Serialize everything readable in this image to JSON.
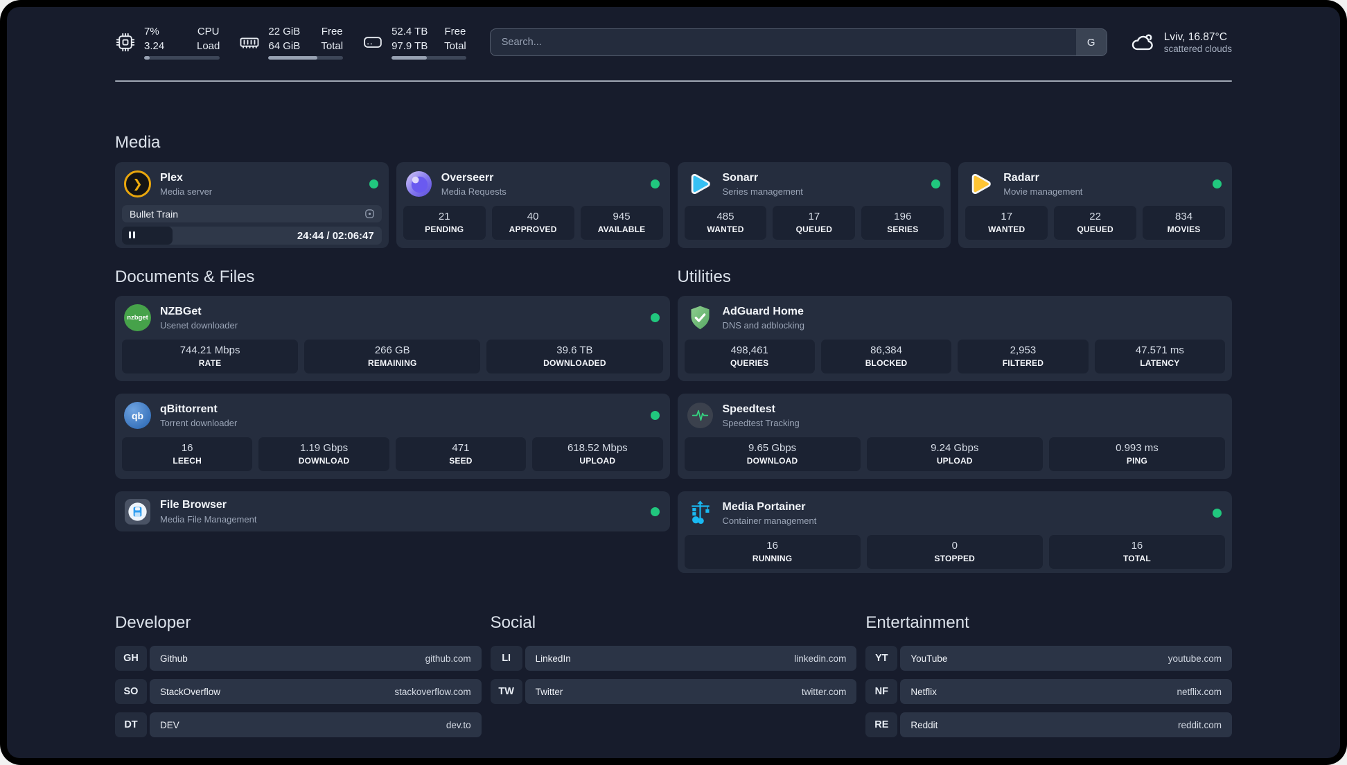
{
  "app": {
    "colors": {
      "accent_green": "#21c77e",
      "panel_bg": "#171c2c",
      "card_bg": "#252d3e",
      "stat_box_bg": "#1b2232",
      "pill_bg": "#2b3446"
    }
  },
  "header": {
    "stats": [
      {
        "icon": "cpu-icon",
        "value_top": "7%",
        "value_bottom": "3.24",
        "label_top": "CPU",
        "label_bottom": "Load",
        "progress_pct": 7
      },
      {
        "icon": "ram-icon",
        "value_top": "22 GiB",
        "value_bottom": "64 GiB",
        "label_top": "Free",
        "label_bottom": "Total",
        "progress_pct": 66
      },
      {
        "icon": "disk-icon",
        "value_top": "52.4 TB",
        "value_bottom": "97.9 TB",
        "label_top": "Free",
        "label_bottom": "Total",
        "progress_pct": 47
      }
    ],
    "search": {
      "placeholder": "Search...",
      "engine_button": "G"
    },
    "weather": {
      "icon": "cloud-icon",
      "location": "Lviv, 16.87°C",
      "condition": "scattered clouds"
    }
  },
  "media": {
    "heading": "Media",
    "plex": {
      "icon": "plex-icon",
      "icon_glyph": "❯",
      "title": "Plex",
      "subtitle": "Media server",
      "now_playing": "Bullet Train",
      "elapsed_pct": 19.5,
      "time": "24:44 / 02:06:47"
    },
    "overseerr": {
      "icon": "overseerr-icon",
      "title": "Overseerr",
      "subtitle": "Media Requests",
      "stats": [
        {
          "value": "21",
          "label": "PENDING"
        },
        {
          "value": "40",
          "label": "APPROVED"
        },
        {
          "value": "945",
          "label": "AVAILABLE"
        }
      ]
    },
    "sonarr": {
      "icon": "sonarr-icon",
      "title": "Sonarr",
      "subtitle": "Series management",
      "stats": [
        {
          "value": "485",
          "label": "WANTED"
        },
        {
          "value": "17",
          "label": "QUEUED"
        },
        {
          "value": "196",
          "label": "SERIES"
        }
      ]
    },
    "radarr": {
      "icon": "radarr-icon",
      "title": "Radarr",
      "subtitle": "Movie management",
      "stats": [
        {
          "value": "17",
          "label": "WANTED"
        },
        {
          "value": "22",
          "label": "QUEUED"
        },
        {
          "value": "834",
          "label": "MOVIES"
        }
      ]
    }
  },
  "documents": {
    "heading": "Documents & Files",
    "nzbget": {
      "icon": "nzbget-icon",
      "logo_text": "nzbget",
      "title": "NZBGet",
      "subtitle": "Usenet downloader",
      "stats": [
        {
          "value": "744.21 Mbps",
          "label": "RATE"
        },
        {
          "value": "266 GB",
          "label": "REMAINING"
        },
        {
          "value": "39.6 TB",
          "label": "DOWNLOADED"
        }
      ]
    },
    "qbittorrent": {
      "icon": "qbittorrent-icon",
      "logo_text": "qb",
      "title": "qBittorrent",
      "subtitle": "Torrent downloader",
      "stats": [
        {
          "value": "16",
          "label": "LEECH"
        },
        {
          "value": "1.19 Gbps",
          "label": "DOWNLOAD"
        },
        {
          "value": "471",
          "label": "SEED"
        },
        {
          "value": "618.52 Mbps",
          "label": "UPLOAD"
        }
      ]
    },
    "filebrowser": {
      "icon": "filebrowser-icon",
      "title": "File Browser",
      "subtitle": "Media File Management"
    }
  },
  "utilities": {
    "heading": "Utilities",
    "adguard": {
      "icon": "adguard-icon",
      "title": "AdGuard Home",
      "subtitle": "DNS and adblocking",
      "stats": [
        {
          "value": "498,461",
          "label": "QUERIES"
        },
        {
          "value": "86,384",
          "label": "BLOCKED"
        },
        {
          "value": "2,953",
          "label": "FILTERED"
        },
        {
          "value": "47.571 ms",
          "label": "LATENCY"
        }
      ]
    },
    "speedtest": {
      "icon": "speedtest-icon",
      "title": "Speedtest",
      "subtitle": "Speedtest Tracking",
      "stats": [
        {
          "value": "9.65 Gbps",
          "label": "DOWNLOAD"
        },
        {
          "value": "9.24 Gbps",
          "label": "UPLOAD"
        },
        {
          "value": "0.993 ms",
          "label": "PING"
        }
      ]
    },
    "portainer": {
      "icon": "portainer-icon",
      "title": "Media Portainer",
      "subtitle": "Container management",
      "stats": [
        {
          "value": "16",
          "label": "RUNNING"
        },
        {
          "value": "0",
          "label": "STOPPED"
        },
        {
          "value": "16",
          "label": "TOTAL"
        }
      ]
    }
  },
  "links": {
    "developer": {
      "heading": "Developer",
      "items": [
        {
          "badge": "GH",
          "name": "Github",
          "domain": "github.com"
        },
        {
          "badge": "SO",
          "name": "StackOverflow",
          "domain": "stackoverflow.com"
        },
        {
          "badge": "DT",
          "name": "DEV",
          "domain": "dev.to"
        }
      ]
    },
    "social": {
      "heading": "Social",
      "items": [
        {
          "badge": "LI",
          "name": "LinkedIn",
          "domain": "linkedin.com"
        },
        {
          "badge": "TW",
          "name": "Twitter",
          "domain": "twitter.com"
        }
      ]
    },
    "entertainment": {
      "heading": "Entertainment",
      "items": [
        {
          "badge": "YT",
          "name": "YouTube",
          "domain": "youtube.com"
        },
        {
          "badge": "NF",
          "name": "Netflix",
          "domain": "netflix.com"
        },
        {
          "badge": "RE",
          "name": "Reddit",
          "domain": "reddit.com"
        }
      ]
    }
  }
}
